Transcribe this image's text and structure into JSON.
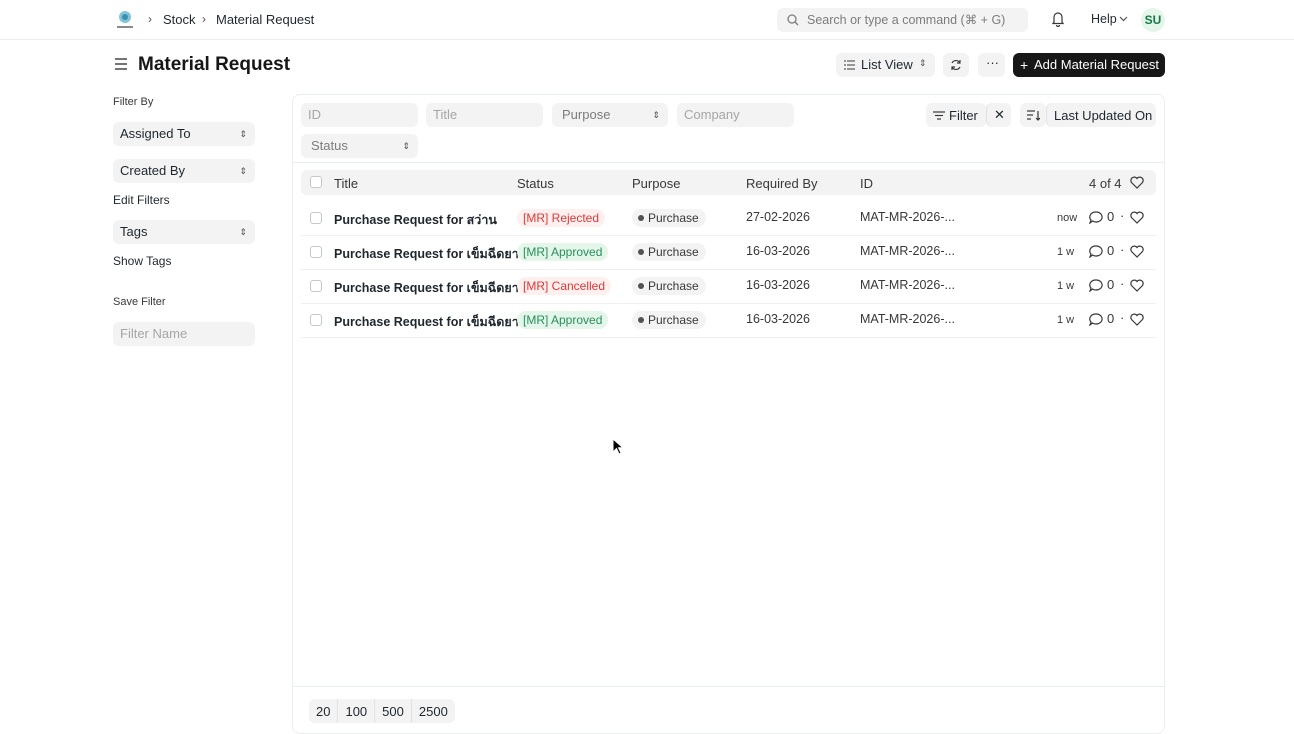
{
  "navbar": {
    "breadcrumbs": [
      "Stock",
      "Material Request"
    ],
    "search_placeholder": "Search or type a command (⌘ + G)",
    "help_label": "Help",
    "avatar_initials": "SU"
  },
  "header": {
    "title": "Material Request",
    "list_view_label": "List View",
    "add_button_label": "Add Material Request"
  },
  "sidebar": {
    "filter_by_label": "Filter By",
    "assigned_to": "Assigned To",
    "created_by": "Created By",
    "edit_filters": "Edit Filters",
    "tags": "Tags",
    "show_tags": "Show Tags",
    "save_filter": "Save Filter",
    "filter_name_placeholder": "Filter Name"
  },
  "filters": {
    "id_placeholder": "ID",
    "title_placeholder": "Title",
    "purpose_placeholder": "Purpose",
    "company_placeholder": "Company",
    "status_placeholder": "Status",
    "filter_label": "Filter",
    "sort_label": "Last Updated On"
  },
  "table": {
    "headers": [
      "Title",
      "Status",
      "Purpose",
      "Required By",
      "ID"
    ],
    "count": "4 of 4",
    "rows": [
      {
        "title": "Purchase Request for สว่าน",
        "status": "[MR] Rejected",
        "status_color": "red",
        "purpose": "Purchase",
        "required_by": "27-02-2026",
        "id": "MAT-MR-2026-...",
        "modified": "now",
        "comments": "0"
      },
      {
        "title": "Purchase Request for เข็มฉีดยา",
        "status": "[MR] Approved",
        "status_color": "green",
        "purpose": "Purchase",
        "required_by": "16-03-2026",
        "id": "MAT-MR-2026-...",
        "modified": "1 w",
        "comments": "0"
      },
      {
        "title": "Purchase Request for เข็มฉีดยา",
        "status": "[MR] Cancelled",
        "status_color": "red",
        "purpose": "Purchase",
        "required_by": "16-03-2026",
        "id": "MAT-MR-2026-...",
        "modified": "1 w",
        "comments": "0"
      },
      {
        "title": "Purchase Request for เข็มฉีดยา",
        "status": "[MR] Approved",
        "status_color": "green",
        "purpose": "Purchase",
        "required_by": "16-03-2026",
        "id": "MAT-MR-2026-...",
        "modified": "1 w",
        "comments": "0"
      }
    ]
  },
  "paging": [
    "20",
    "100",
    "500",
    "2500"
  ]
}
